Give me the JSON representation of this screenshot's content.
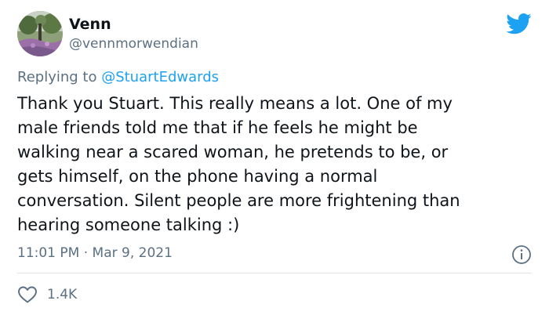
{
  "user": {
    "name": "Venn",
    "handle": "@vennmorwendian"
  },
  "reply": {
    "prefix": "Replying to ",
    "mention": "@StuartEdwards"
  },
  "tweet": {
    "lines": [
      "Thank you Stuart. This really means a lot. One of my",
      "male friends told me that if he feels he might be",
      "walking near a scared woman, he pretends to be, or",
      "gets himself, on the phone having a normal",
      "conversation. Silent people are more frightening than",
      "hearing someone talking :)"
    ]
  },
  "meta": {
    "time": "11:01 PM",
    "separator": " · ",
    "date": "Mar 9, 2021"
  },
  "actions": {
    "like_count": "1.4K"
  },
  "colors": {
    "brand_blue": "#1da1f2",
    "secondary_text": "#5b7083",
    "primary_text": "#0f1419"
  },
  "icons": {
    "logo": "twitter-bird-icon",
    "info": "info-icon",
    "like": "heart-icon"
  }
}
